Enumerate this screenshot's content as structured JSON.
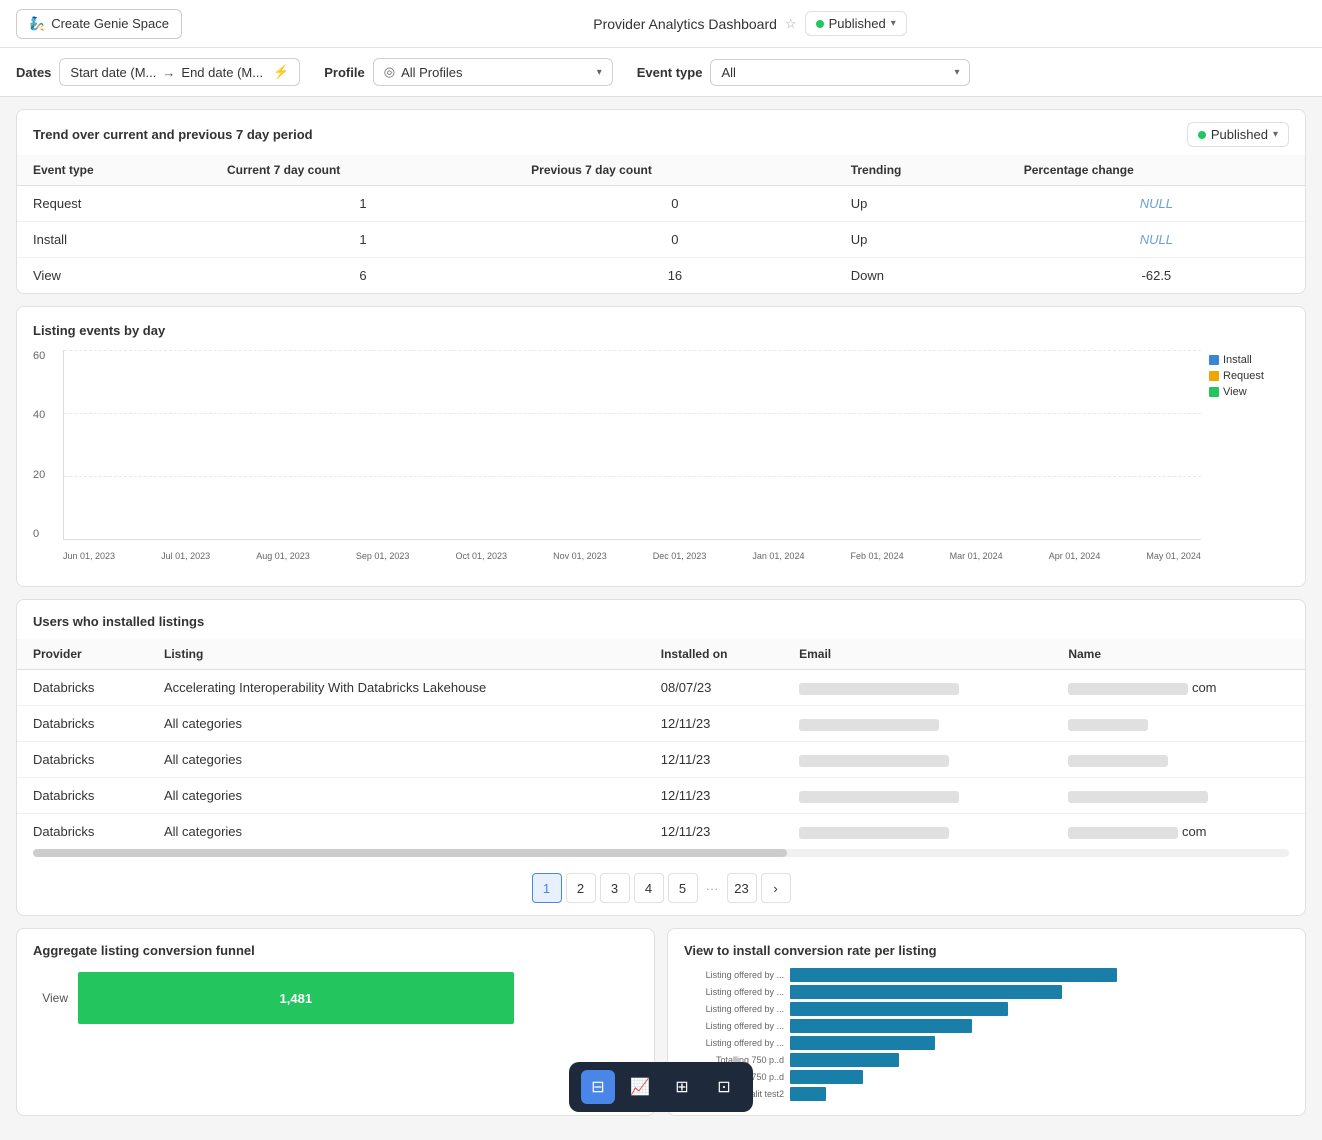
{
  "header": {
    "create_btn_label": "Create Genie Space",
    "dashboard_title": "Provider Analytics Dashboard",
    "published_label": "Published"
  },
  "filters": {
    "dates_label": "Dates",
    "dates_start": "Start date (M...",
    "dates_arrow": "→",
    "dates_end": "End date (M...",
    "profile_label": "Profile",
    "profile_value": "All Profiles",
    "event_label": "Event type",
    "event_value": "All"
  },
  "trend": {
    "title": "Trend over current and previous 7 day period",
    "published_label": "Published",
    "columns": [
      "Event type",
      "Current 7 day count",
      "Previous 7 day count",
      "Trending",
      "Percentage change"
    ],
    "rows": [
      {
        "event_type": "Request",
        "current": "1",
        "previous": "0",
        "trending": "Up",
        "pct_change": "NULL"
      },
      {
        "event_type": "Install",
        "current": "1",
        "previous": "0",
        "trending": "Up",
        "pct_change": "NULL"
      },
      {
        "event_type": "View",
        "current": "6",
        "previous": "16",
        "trending": "Down",
        "pct_change": "-62.5"
      }
    ]
  },
  "chart": {
    "title": "Listing events by day",
    "y_labels": [
      "60",
      "40",
      "20",
      "0"
    ],
    "x_labels": [
      "Jun 01, 2023",
      "Jul 01, 2023",
      "Aug 01, 2023",
      "Sep 01, 2023",
      "Oct 01, 2023",
      "Nov 01, 2023",
      "Dec 01, 2023",
      "Jan 01, 2024",
      "Feb 01, 2024",
      "Mar 01, 2024",
      "Apr 01, 2024",
      "May 01, 2024"
    ],
    "legend": [
      {
        "label": "Install",
        "color": "#3a86d4"
      },
      {
        "label": "Request",
        "color": "#f0a500"
      },
      {
        "label": "View",
        "color": "#22c55e"
      }
    ]
  },
  "users_table": {
    "title": "Users who installed listings",
    "columns": [
      "Provider",
      "Listing",
      "Installed on",
      "Email",
      "Name"
    ],
    "rows": [
      {
        "provider": "Databricks",
        "listing": "Accelerating Interoperability With Databricks Lakehouse",
        "installed_on": "08/07/23",
        "email_width": 160,
        "name_width": 120,
        "name_suffix": "com"
      },
      {
        "provider": "Databricks",
        "listing": "All categories",
        "installed_on": "12/11/23",
        "email_width": 140,
        "name_width": 80,
        "name_suffix": ""
      },
      {
        "provider": "Databricks",
        "listing": "All categories",
        "installed_on": "12/11/23",
        "email_width": 150,
        "name_width": 100,
        "name_suffix": ""
      },
      {
        "provider": "Databricks",
        "listing": "All categories",
        "installed_on": "12/11/23",
        "email_width": 160,
        "name_width": 140,
        "name_suffix": ""
      },
      {
        "provider": "Databricks",
        "listing": "All categories",
        "installed_on": "12/11/23",
        "email_width": 150,
        "name_width": 110,
        "name_suffix": "com"
      }
    ]
  },
  "pagination": {
    "pages": [
      "1",
      "2",
      "3",
      "4",
      "5",
      "...",
      "23"
    ],
    "active": "1",
    "next_label": "›"
  },
  "funnel": {
    "title": "Aggregate listing conversion funnel",
    "label": "View",
    "value": "1,481",
    "bar_width_pct": 70
  },
  "conversion": {
    "title": "View to install conversion rate per listing",
    "bars": [
      {
        "label": "Listing offered by ...",
        "width_pct": 90
      },
      {
        "label": "Listing offered by ...",
        "width_pct": 75
      },
      {
        "label": "Listing offered by ...",
        "width_pct": 60
      },
      {
        "label": "Listing offered by ...",
        "width_pct": 50
      },
      {
        "label": "Listing offered by ...",
        "width_pct": 40
      },
      {
        "label": "Totalling 750 p..d",
        "width_pct": 30
      },
      {
        "label": "Totalling 750 p..d",
        "width_pct": 20
      },
      {
        "label": "modalit test2",
        "width_pct": 10
      }
    ]
  },
  "toolbar": {
    "filter_icon": "⊟",
    "line_icon": "⌇",
    "grid_icon": "⊞",
    "funnel_icon": "⊡"
  }
}
